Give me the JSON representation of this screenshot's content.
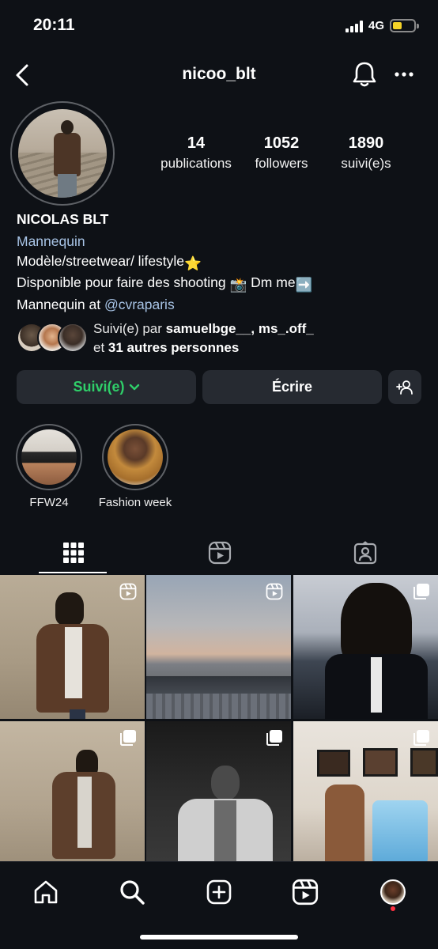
{
  "status_bar": {
    "time": "20:11",
    "network": "4G",
    "battery_level": 0.45
  },
  "header": {
    "username": "nicoo_blt",
    "back_icon": "chevron-left-icon",
    "bell_icon": "bell-icon",
    "more_icon": "more-horizontal-icon"
  },
  "profile": {
    "stats": [
      {
        "value": "14",
        "label": "publications"
      },
      {
        "value": "1052",
        "label": "followers"
      },
      {
        "value": "1890",
        "label": "suivi(e)s"
      }
    ],
    "name": "NICOLAS BLT",
    "category": "Mannequin",
    "bio_lines": [
      {
        "text": "Modèle/streetwear/ lifestyle",
        "emoji": "⭐"
      },
      {
        "text": "Disponible pour faire des shooting",
        "emoji_1": "📸",
        "text_2": "Dm me",
        "emoji_2": "➡️"
      },
      {
        "text": "Mannequin at",
        "mention": "@cvraparis"
      }
    ]
  },
  "mutual": {
    "prefix": "Suivi(e) par",
    "names": "samuelbge__, ms_.off_",
    "and": "et",
    "others": "31 autres personnes"
  },
  "actions": {
    "follow_label": "Suivi(e)",
    "message_label": "Écrire",
    "add_user_icon": "add-user-icon"
  },
  "highlights": [
    {
      "label": "FFW24"
    },
    {
      "label": "Fashion week"
    }
  ],
  "tabs": [
    {
      "icon": "grid-icon",
      "active": true
    },
    {
      "icon": "reels-icon",
      "active": false
    },
    {
      "icon": "tagged-icon",
      "active": false
    }
  ],
  "grid_posts": [
    {
      "type": "reel",
      "badge_icon": "reels-icon"
    },
    {
      "type": "reel",
      "badge_icon": "reels-icon"
    },
    {
      "type": "carousel",
      "badge_icon": "carousel-icon"
    },
    {
      "type": "carousel",
      "badge_icon": "carousel-icon"
    },
    {
      "type": "carousel",
      "badge_icon": "carousel-icon"
    },
    {
      "type": "carousel",
      "badge_icon": "carousel-icon"
    }
  ],
  "bottom_nav": [
    {
      "icon": "home-icon"
    },
    {
      "icon": "search-icon"
    },
    {
      "icon": "create-icon"
    },
    {
      "icon": "reels-icon"
    },
    {
      "icon": "profile-avatar"
    }
  ],
  "colors": {
    "background": "#0e1116",
    "button_bg": "#262a31",
    "follow_green": "#2fce69",
    "link_blue": "#a8c4e6",
    "notification_red": "#ff3040"
  }
}
